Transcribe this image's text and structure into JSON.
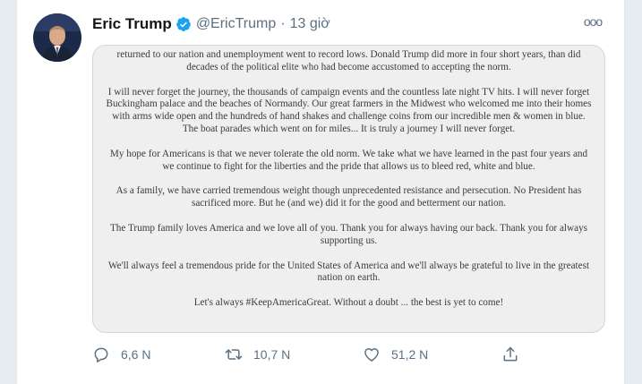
{
  "tweet": {
    "author_name": "Eric Trump",
    "handle": "@EricTrump",
    "separator": "·",
    "time": "13 giờ",
    "more_label": "ooo"
  },
  "letter": {
    "paragraphs": [
      "returned to our nation and unemployment went to record lows. Donald Trump did more in four short years, than did decades of the political elite who had become accustomed to accepting the norm.",
      "I will never forget the journey, the thousands of campaign events and the countless late night TV hits. I will never forget Buckingham palace and the beaches of Normandy. Our great farmers in the Midwest who welcomed me into their homes with arms wide open and the hundreds of hand shakes and challenge coins from our incredible men & women in blue. The boat parades which went on for miles... It is truly a journey I will never forget.",
      "My hope for Americans is that we never tolerate the old norm. We take what we have learned in the past four years and we continue to fight for the liberties and the pride that allows us to bleed red, white and blue.",
      "As a family, we have carried tremendous weight though unprecedented resistance and persecution. No President has sacrificed more. But he (and we) did it for the good and betterment our nation.",
      "The Trump family loves America and we love all of you. Thank you for always having our back. Thank you for always supporting us.",
      "We'll always feel a tremendous pride for the United States of America and we'll always be grateful to live in the greatest nation on earth.",
      "Let's always #KeepAmericaGreat. Without a doubt ... the best is yet to come!"
    ]
  },
  "actions": {
    "replies": "6,6 N",
    "retweets": "10,7 N",
    "likes": "51,2 N"
  },
  "colors": {
    "text_secondary": "#5b7083",
    "verified_blue": "#1da1f2",
    "background": "#e6ecf0"
  },
  "icons": [
    "verified-badge-icon",
    "more-icon",
    "reply-icon",
    "retweet-icon",
    "like-icon",
    "share-icon"
  ]
}
